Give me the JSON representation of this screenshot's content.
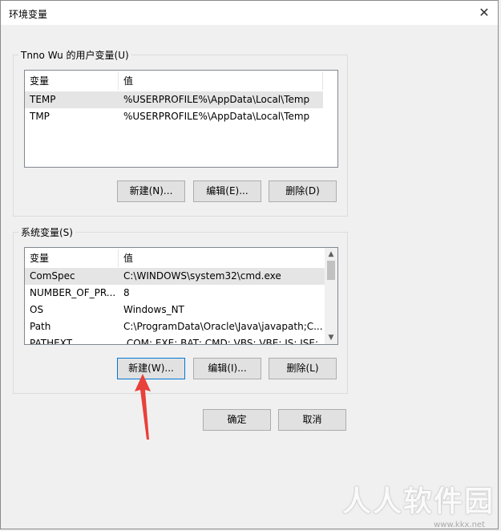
{
  "window": {
    "title": "环境变量",
    "close_glyph": "✕"
  },
  "user_group": {
    "label": "Tnno Wu 的用户变量(U)",
    "columns": [
      "变量",
      "值"
    ],
    "rows": [
      {
        "name": "TEMP",
        "value": "%USERPROFILE%\\AppData\\Local\\Temp",
        "selected": true
      },
      {
        "name": "TMP",
        "value": "%USERPROFILE%\\AppData\\Local\\Temp",
        "selected": false
      }
    ],
    "buttons": {
      "new": "新建(N)...",
      "edit": "编辑(E)...",
      "delete": "删除(D)"
    }
  },
  "system_group": {
    "label": "系统变量(S)",
    "columns": [
      "变量",
      "值"
    ],
    "rows": [
      {
        "name": "ComSpec",
        "value": "C:\\WINDOWS\\system32\\cmd.exe",
        "selected": true
      },
      {
        "name": "NUMBER_OF_PR...",
        "value": "8",
        "selected": false
      },
      {
        "name": "OS",
        "value": "Windows_NT",
        "selected": false
      },
      {
        "name": "Path",
        "value": "C:\\ProgramData\\Oracle\\Java\\javapath;C...",
        "selected": false
      },
      {
        "name": "PATHEXT",
        "value": ".COM;.EXE;.BAT;.CMD;.VBS;.VBE;.JS;.JSE;...",
        "selected": false
      }
    ],
    "buttons": {
      "new": "新建(W)...",
      "edit": "编辑(I)...",
      "delete": "删除(L)"
    }
  },
  "footer": {
    "ok": "确定",
    "cancel": "取消"
  },
  "annotation": {
    "arrow_color": "#e8403a"
  },
  "watermark": {
    "text": "人人软件园",
    "url": "www.kkx.net"
  }
}
